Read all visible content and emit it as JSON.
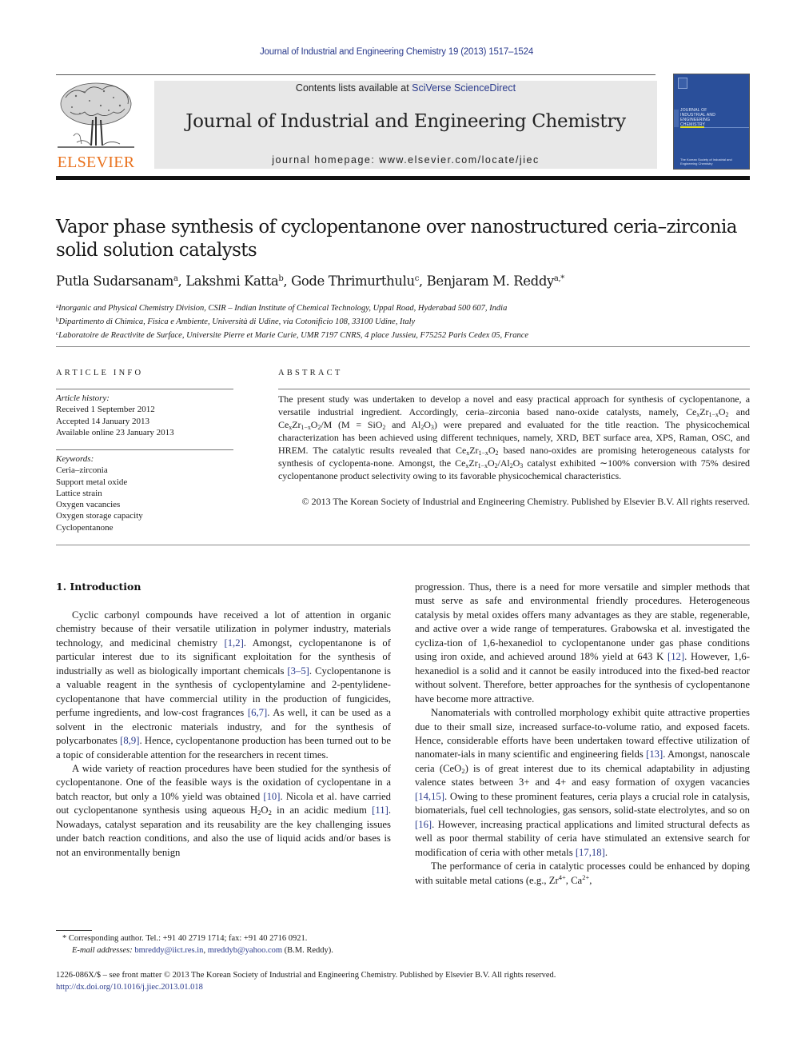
{
  "running_head": {
    "text": "Journal of Industrial and Engineering Chemistry 19 (2013) 1517–1524"
  },
  "masthead": {
    "contents_prefix": "Contents lists available at ",
    "contents_link": "SciVerse ScienceDirect",
    "journal_name": "Journal of Industrial and Engineering Chemistry",
    "homepage": "journal homepage: www.elsevier.com/locate/jiec",
    "publisher_logo_text": "ELSEVIER",
    "cover_title_lines": [
      "Journal of",
      "Industrial and",
      "Engineering",
      "Chemistry"
    ],
    "cover_footer": "The Korean Society of Industrial and Engineering Chemistry",
    "colors": {
      "brand_orange": "#e9711c",
      "cover_blue": "#2a4f9a",
      "link_blue": "#2a3a8c"
    }
  },
  "article": {
    "title": "Vapor phase synthesis of cyclopentanone over nanostructured ceria–zirconia solid solution catalysts",
    "authors": [
      {
        "name": "Putla Sudarsanam",
        "affil": "a",
        "sep": ", "
      },
      {
        "name": "Lakshmi Katta",
        "affil": "b",
        "sep": ", "
      },
      {
        "name": "Gode Thrimurthulu",
        "affil": "c",
        "sep": ", "
      },
      {
        "name": "Benjaram M. Reddy",
        "affil": "a,*",
        "sep": ""
      }
    ],
    "affiliations": [
      {
        "key": "a",
        "text": "Inorganic and Physical Chemistry Division, CSIR – Indian Institute of Chemical Technology, Uppal Road, Hyderabad 500 607, India"
      },
      {
        "key": "b",
        "text": "Dipartimento di Chimica, Fisica e Ambiente, Università di Udine, via Cotonificio 108, 33100 Udine, Italy"
      },
      {
        "key": "c",
        "text": "Laboratoire de Reactivite de Surface, Universite Pierre et Marie Curie, UMR 7197 CNRS, 4 place Jussieu, F75252 Paris Cedex 05, France"
      }
    ]
  },
  "article_info": {
    "label": "ARTICLE INFO",
    "history_label": "Article history:",
    "history": [
      "Received 1 September 2012",
      "Accepted 14 January 2013",
      "Available online 23 January 2013"
    ],
    "keywords_label": "Keywords:",
    "keywords": [
      "Ceria–zirconia",
      "Support metal oxide",
      "Lattice strain",
      "Oxygen vacancies",
      "Oxygen storage capacity",
      "Cyclopentanone"
    ]
  },
  "abstract": {
    "label": "ABSTRACT",
    "s1": "The present study was undertaken to develop a novel and easy practical approach for synthesis of cyclopentanone, a versatile industrial ingredient. Accordingly, ceria–zirconia based nano-oxide catalysts, namely, Ce",
    "s2": " and Ce",
    "s3": "/M (M = SiO",
    "s4": " and Al",
    "s5": ") were prepared and evaluated for the title reaction. The physicochemical characterization has been achieved using different techniques, namely, XRD, BET surface area, XPS, Raman, OSC, and HREM. The catalytic results revealed that Ce",
    "s6": " based nano-oxides are promising heterogeneous catalysts for synthesis of cyclopenta-none. Amongst, the Ce",
    "s7": " catalyst exhibited ∼100% conversion with 75% desired cyclopentanone product selectivity owing to its favorable physicochemical characteristics.",
    "copyright": "© 2013 The Korean Society of Industrial and Engineering Chemistry. Published by Elsevier B.V. All rights reserved."
  },
  "body": {
    "intro_heading": "1.  Introduction",
    "left": {
      "p1a": "Cyclic carbonyl compounds have received a lot of attention in organic chemistry because of their versatile utilization in polymer industry, materials technology, and medicinal chemistry ",
      "ref1": "[1,2]",
      "p1b": ". Amongst, cyclopentanone is of particular interest due to its significant exploitation for the synthesis of industrially as well as biologically important chemicals ",
      "ref2": "[3–5]",
      "p1c": ". Cyclopentanone is a valuable reagent in the synthesis of cyclopentylamine and 2-pentylidene-cyclopentanone that have commercial utility in the production of fungicides, perfume ingredients, and low-cost fragrances ",
      "ref3": "[6,7]",
      "p1d": ". As well, it can be used as a solvent in the electronic materials industry, and for the synthesis of polycarbonates ",
      "ref4": "[8,9]",
      "p1e": ". Hence, cyclopentanone production has been turned out to be a topic of considerable attention for the researchers in recent times.",
      "p2a": "A wide variety of reaction procedures have been studied for the synthesis of cyclopentanone. One of the feasible ways is the oxidation of cyclopentane in a batch reactor, but only a 10% yield was obtained ",
      "ref5": "[10]",
      "p2b": ". Nicola et al. have carried out cyclopentanone synthesis using aqueous H",
      "p2c": "O",
      "p2d": " in an acidic medium ",
      "ref6": "[11]",
      "p2e": ". Nowadays, catalyst separation and its reusability are the key challenging issues under batch reaction conditions, and also the use of liquid acids and/or bases is not an environmentally benign"
    },
    "right": {
      "p1a": "progression. Thus, there is a need for more versatile and simpler methods that must serve as safe and environmental friendly procedures. Heterogeneous catalysis by metal oxides offers many advantages as they are stable, regenerable, and active over a wide range of temperatures. Grabowska et al. investigated the cycliza-tion of 1,6-hexanediol to cyclopentanone under gas phase conditions using iron oxide, and achieved around 18% yield at 643 K ",
      "ref1": "[12]",
      "p1b": ". However, 1,6-hexanediol is a solid and it cannot be easily introduced into the fixed-bed reactor without solvent. Therefore, better approaches for the synthesis of cyclopentanone have become more attractive.",
      "p2a": "Nanomaterials with controlled morphology exhibit quite attractive properties due to their small size, increased surface-to-volume ratio, and exposed facets. Hence, considerable efforts have been undertaken toward effective utilization of nanomater-ials in many scientific and engineering fields ",
      "ref2": "[13]",
      "p2b": ". Amongst, nanoscale ceria (CeO",
      "p2c": ") is of great interest due to its chemical adaptability in adjusting valence states between 3+ and 4+ and easy formation of oxygen vacancies ",
      "ref3": "[14,15]",
      "p2d": ". Owing to these prominent features, ceria plays a crucial role in catalysis, biomaterials, fuel cell technologies, gas sensors, solid-state electrolytes, and so on ",
      "ref4": "[16]",
      "p2e": ". However, increasing practical applications and limited structural defects as well as poor thermal stability of ceria have stimulated an extensive search for modification of ceria with other metals ",
      "ref5": "[17,18]",
      "p2f": ".",
      "p3a": "The performance of ceria in catalytic processes could be enhanced by doping with suitable metal cations (e.g., Zr",
      "p3b": ", Ca",
      "p3c": ","
    }
  },
  "footnote": {
    "marker": "*",
    "corresponding": "Corresponding author. Tel.: +91 40 2719 1714; fax: +91 40 2716 0921.",
    "email_label": "E-mail addresses:",
    "email1": "bmreddy@iict.res.in",
    "email2": "mreddyb@yahoo.com",
    "email_suffix": "(B.M. Reddy)."
  },
  "bottom": {
    "issn_line": "1226-086X/$ – see front matter © 2013 The Korean Society of Industrial and Engineering Chemistry. Published by Elsevier B.V. All rights reserved.",
    "doi": "http://dx.doi.org/10.1016/j.jiec.2013.01.018"
  }
}
